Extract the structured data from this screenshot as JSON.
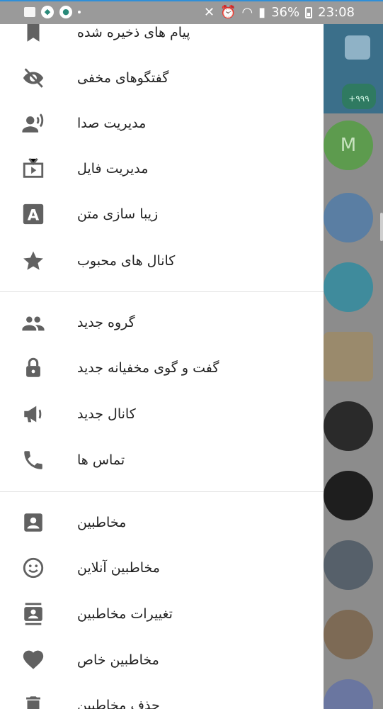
{
  "status_bar": {
    "battery": "36%",
    "time": "23:08"
  },
  "menu_sections": [
    [
      {
        "label": "پیام های ذخیره شده",
        "icon": "bookmark-icon"
      },
      {
        "label": "گفتگوهای مخفی",
        "icon": "eye-off-icon"
      },
      {
        "label": "مدیریت صدا",
        "icon": "voice-icon"
      },
      {
        "label": "مدیریت فایل",
        "icon": "tv-icon"
      },
      {
        "label": "زیبا سازی متن",
        "icon": "font-icon"
      },
      {
        "label": "کانال های محبوب",
        "icon": "star-icon"
      }
    ],
    [
      {
        "label": "گروه جدید",
        "icon": "group-icon"
      },
      {
        "label": "گفت و گوی مخفیانه جدید",
        "icon": "lock-icon"
      },
      {
        "label": "کانال جدید",
        "icon": "megaphone-icon"
      },
      {
        "label": "تماس ها",
        "icon": "phone-icon"
      }
    ],
    [
      {
        "label": "مخاطبین",
        "icon": "contact-icon"
      },
      {
        "label": "مخاطبین آنلاین",
        "icon": "smile-icon"
      },
      {
        "label": "تغییرات مخاطبین",
        "icon": "contacts-book-icon"
      },
      {
        "label": "مخاطبین خاص",
        "icon": "heart-icon"
      },
      {
        "label": "حذف مخاطبین",
        "icon": "trash-icon"
      }
    ]
  ],
  "chat_list": {
    "badge": "+۹۹۹",
    "avatar_letter": "M"
  }
}
